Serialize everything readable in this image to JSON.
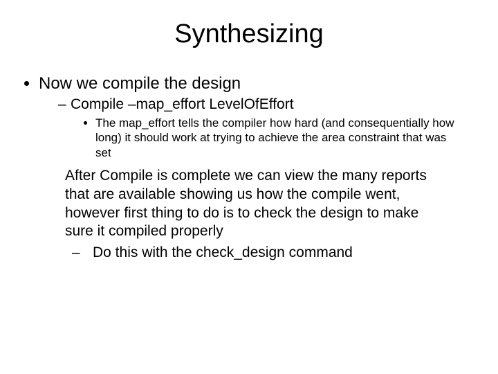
{
  "title": "Synthesizing",
  "bullets": {
    "l1": "Now we compile the design",
    "l2": "Compile –map_effort LevelOfEffort",
    "l3": "The map_effort tells the compiler how hard (and consequentially how long) it should work at trying to achieve the area constraint that was set",
    "para": "After Compile is complete we can view the many reports that are available showing us how the compile went, however first thing to do is to check the design to make sure it compiled properly",
    "l2b": "Do this with the check_design command"
  }
}
